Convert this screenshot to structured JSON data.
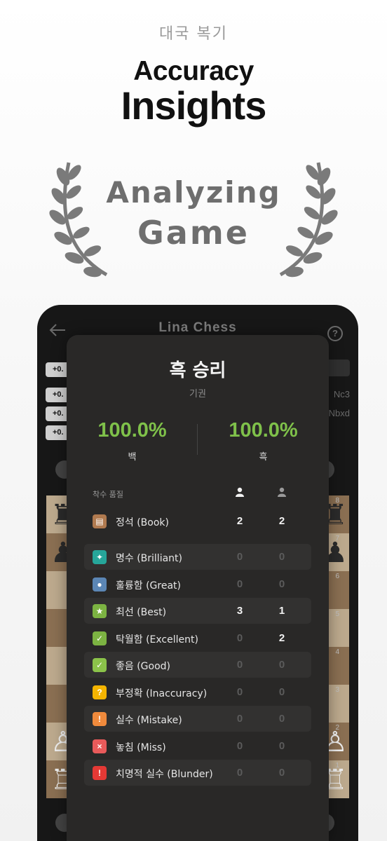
{
  "hero": {
    "subtitle": "대국 복기",
    "title_line1": "Accuracy",
    "title_line2": "Insights",
    "badge_line1": "Analyzing",
    "badge_line2": "Game"
  },
  "app": {
    "title": "Lina Chess",
    "help_glyph": "?",
    "eval_badges": [
      "+0.",
      "+0.",
      "+0.",
      "+0."
    ],
    "moves": [
      "Nc3",
      "Nbxd"
    ],
    "ranks": [
      "8",
      "7",
      "6",
      "5",
      "4",
      "3",
      "2",
      "1"
    ]
  },
  "result": {
    "title": "흑 승리",
    "reason": "기권",
    "white_accuracy": "100.0%",
    "black_accuracy": "100.0%",
    "white_label": "백",
    "black_label": "흑",
    "quality_header": "착수 품질",
    "rows": [
      {
        "label": "정석 (Book)",
        "white": "2",
        "black": "2",
        "color": "#b07a4f",
        "icon": "book-icon"
      },
      {
        "label": "명수 (Brilliant)",
        "white": "0",
        "black": "0",
        "color": "#26a69a",
        "icon": "sparkle-icon"
      },
      {
        "label": "훌륭함 (Great)",
        "white": "0",
        "black": "0",
        "color": "#5b86b5",
        "icon": "medal-icon"
      },
      {
        "label": "최선 (Best)",
        "white": "3",
        "black": "1",
        "color": "#7cb342",
        "icon": "star-icon"
      },
      {
        "label": "탁월함 (Excellent)",
        "white": "0",
        "black": "2",
        "color": "#7cb342",
        "icon": "thumbs-up-icon"
      },
      {
        "label": "좋음 (Good)",
        "white": "0",
        "black": "0",
        "color": "#8bc34a",
        "icon": "check-icon"
      },
      {
        "label": "부정확 (Inaccuracy)",
        "white": "0",
        "black": "0",
        "color": "#f4b400",
        "icon": "question-icon"
      },
      {
        "label": "실수 (Mistake)",
        "white": "0",
        "black": "0",
        "color": "#f08a3c",
        "icon": "warning-icon"
      },
      {
        "label": "놓침 (Miss)",
        "white": "0",
        "black": "0",
        "color": "#e85a5a",
        "icon": "miss-icon"
      },
      {
        "label": "치명적 실수 (Blunder)",
        "white": "0",
        "black": "0",
        "color": "#e53935",
        "icon": "blunder-icon"
      }
    ]
  }
}
